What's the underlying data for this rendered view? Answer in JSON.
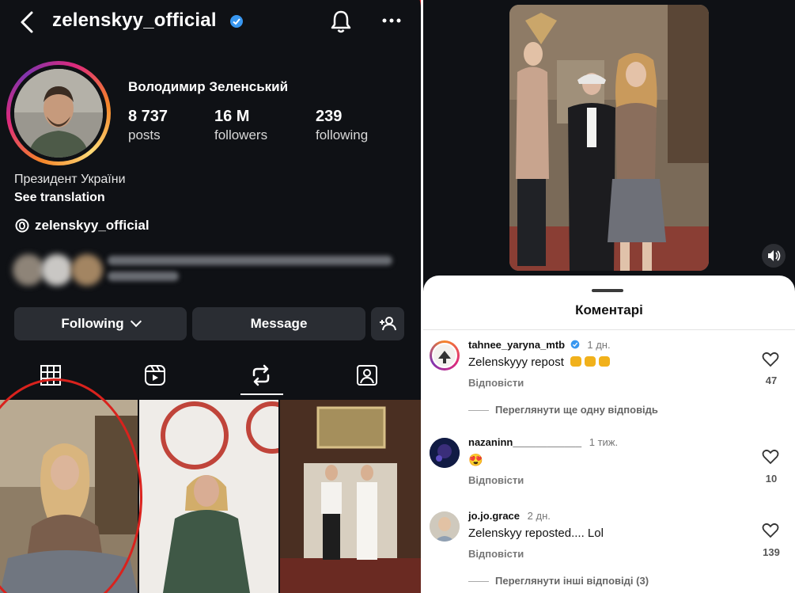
{
  "profile": {
    "username": "zelenskyy_official",
    "full_name": "Володимир Зеленський",
    "stats": [
      {
        "value": "8 737",
        "label": "posts"
      },
      {
        "value": "16 M",
        "label": "followers"
      },
      {
        "value": "239",
        "label": "following"
      }
    ],
    "bio_category": "Президент України",
    "see_translation": "See translation",
    "threads_handle": "zelenskyy_official",
    "buttons": {
      "following": "Following",
      "message": "Message"
    },
    "tabs": [
      "grid-icon",
      "reels-icon",
      "reposts-icon",
      "tagged-icon"
    ],
    "active_tab": "reposts-icon"
  },
  "comments_sheet": {
    "title": "Коментарі",
    "comments": [
      {
        "user": "tahnee_yaryna_mtb",
        "verified": true,
        "time": "1 дн.",
        "text": "Zelenskyyy repost",
        "reply_label": "Відповісти",
        "likes": "47",
        "view_more": "Переглянути ще одну відповідь"
      },
      {
        "user": "nazaninn____________",
        "verified": false,
        "time": "1 тиж.",
        "text": "😍",
        "reply_label": "Відповісти",
        "likes": "10"
      },
      {
        "user": "jo.jo.grace",
        "verified": false,
        "time": "2 дн.",
        "text": "Zelenskyy reposted.... Lol",
        "reply_label": "Відповісти",
        "likes": "139",
        "view_more": "Переглянути інші відповіді (3)"
      }
    ]
  },
  "colors": {
    "background_dark": "#0f1115",
    "button_dark": "#2a2d33",
    "verified_blue": "#3897f0",
    "annotation_red": "#d9221d"
  }
}
